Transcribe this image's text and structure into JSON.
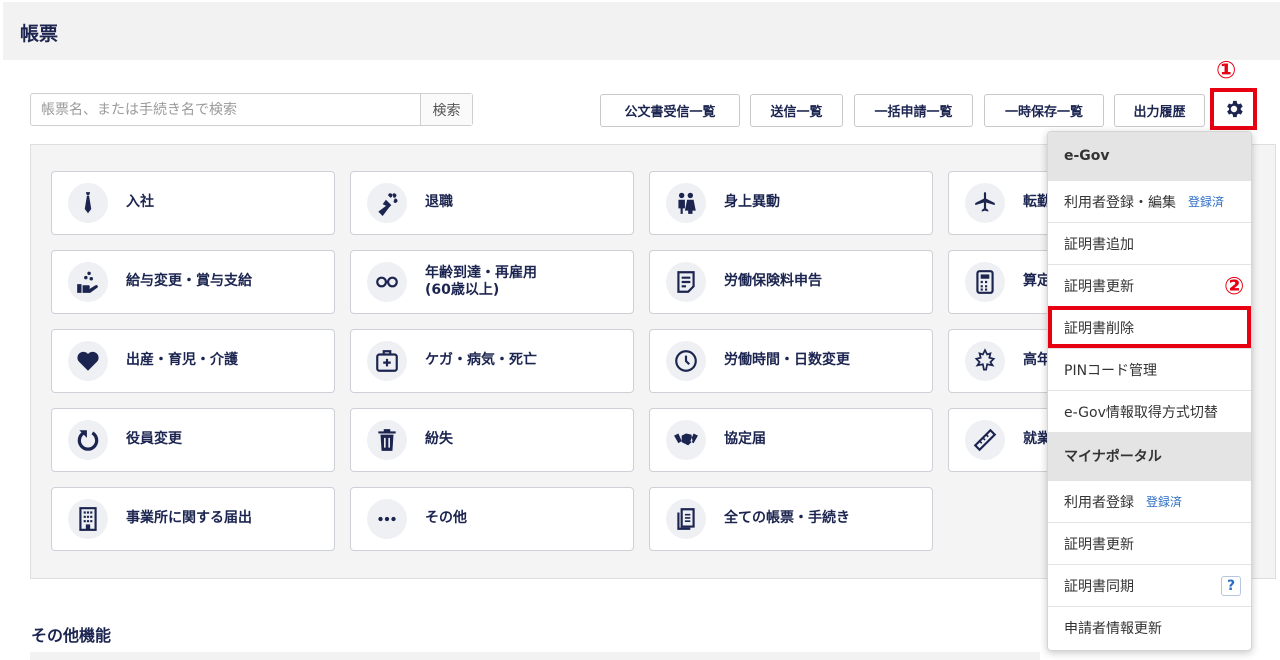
{
  "page": {
    "title": "帳票"
  },
  "search": {
    "placeholder": "帳票名、または手続き名で検索",
    "button": "検索"
  },
  "toolbar": {
    "received": "公文書受信一覧",
    "sent": "送信一覧",
    "bulk": "一括申請一覧",
    "saved": "一時保存一覧",
    "output": "出力履歴"
  },
  "annotations": {
    "n1": "①",
    "n2": "②"
  },
  "tiles": [
    {
      "label": "入社",
      "icon": "tie-icon"
    },
    {
      "label": "退職",
      "icon": "bouquet-icon"
    },
    {
      "label": "身上異動",
      "icon": "wedding-couple-icon"
    },
    {
      "label": "転勤",
      "icon": "airplane-icon"
    },
    {
      "label": "給与変更・賞与支給",
      "icon": "hand-coins-icon"
    },
    {
      "label": "年齢到達・再雇用\n(60歳以上)",
      "icon": "glasses-icon"
    },
    {
      "label": "労働保険料申告",
      "icon": "document-icon"
    },
    {
      "label": "算定",
      "icon": "calculator-icon"
    },
    {
      "label": "出産・育児・介護",
      "icon": "heart-icon"
    },
    {
      "label": "ケガ・病気・死亡",
      "icon": "first-aid-icon"
    },
    {
      "label": "労働時間・日数変更",
      "icon": "clock-icon"
    },
    {
      "label": "高年",
      "icon": "maple-leaf-icon"
    },
    {
      "label": "役員変更",
      "icon": "rotate-icon"
    },
    {
      "label": "紛失",
      "icon": "trash-icon"
    },
    {
      "label": "協定届",
      "icon": "handshake-icon"
    },
    {
      "label": "就業",
      "icon": "ruler-icon"
    },
    {
      "label": "事業所に関する届出",
      "icon": "building-icon"
    },
    {
      "label": "その他",
      "icon": "ellipsis-icon"
    },
    {
      "label": "全ての帳票・手続き",
      "icon": "documents-icon"
    }
  ],
  "other": {
    "title": "その他機能"
  },
  "menu": {
    "egov_header": "e-Gov",
    "egov_items": [
      {
        "label": "利用者登録・編集",
        "badge": "登録済"
      },
      {
        "label": "証明書追加"
      },
      {
        "label": "証明書更新"
      },
      {
        "label": "証明書削除"
      },
      {
        "label": "PINコード管理"
      },
      {
        "label": "e-Gov情報取得方式切替"
      }
    ],
    "myna_header": "マイナポータル",
    "myna_items": [
      {
        "label": "利用者登録",
        "badge": "登録済"
      },
      {
        "label": "証明書更新"
      },
      {
        "label": "証明書同期",
        "help": "?"
      },
      {
        "label": "申請者情報更新"
      }
    ]
  },
  "colors": {
    "navy": "#1c2550",
    "highlight": "#e60012",
    "link": "#2b6cc4"
  }
}
